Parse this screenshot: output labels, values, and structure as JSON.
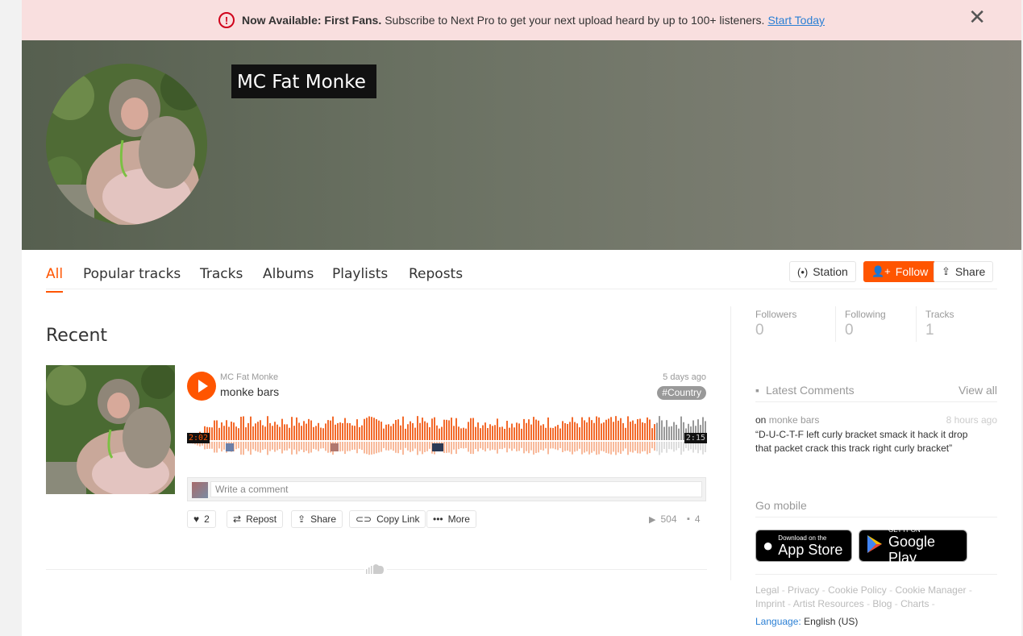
{
  "banner": {
    "headline": "Now Available: First Fans.",
    "text": "Subscribe to Next Pro to get your next upload heard by up to 100+ listeners.",
    "link": "Start Today"
  },
  "profile": {
    "name": "MC Fat Monke"
  },
  "tabs": [
    "All",
    "Popular tracks",
    "Tracks",
    "Albums",
    "Playlists",
    "Reposts"
  ],
  "actions": {
    "station": "Station",
    "follow": "Follow",
    "share": "Share"
  },
  "recent": {
    "heading": "Recent",
    "track": {
      "artist": "MC Fat Monke",
      "title": "monke bars",
      "posted": "5 days ago",
      "tag": "#Country",
      "current_time": "2:02",
      "duration": "2:15",
      "progress": 0.9,
      "comment_placeholder": "Write a comment",
      "likes": "2",
      "repost": "Repost",
      "share": "Share",
      "copy_link": "Copy Link",
      "more": "More",
      "plays": "504",
      "comments": "4"
    }
  },
  "sidebar": {
    "stats": [
      {
        "label": "Followers",
        "value": "0"
      },
      {
        "label": "Following",
        "value": "0"
      },
      {
        "label": "Tracks",
        "value": "1"
      }
    ],
    "latest_comments": {
      "heading": "Latest Comments",
      "view_all": "View all",
      "on": "on",
      "track": "monke bars",
      "time": "8 hours ago",
      "body": "“D-U-C-T-F left curly bracket smack it hack it drop that packet crack this track right curly bracket”"
    },
    "go_mobile": "Go mobile",
    "app_store": {
      "small": "Download on the",
      "big": "App Store"
    },
    "google_play": {
      "small": "GET IT ON",
      "big": "Google Play"
    },
    "footer_links": [
      "Legal",
      "Privacy",
      "Cookie Policy",
      "Cookie Manager",
      "Imprint",
      "Artist Resources",
      "Blog",
      "Charts"
    ],
    "language_label": "Language:",
    "language": "English (US)"
  },
  "colors": {
    "accent": "#ff5500",
    "banner_bg": "#f9dfdf",
    "alert": "#d0021b",
    "link": "#2a7fd4"
  }
}
